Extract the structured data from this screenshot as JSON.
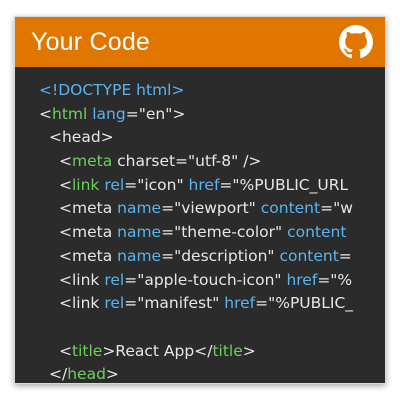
{
  "header": {
    "title": "Your Code",
    "icon": "github-icon",
    "accent_color": "#e07600"
  },
  "code": {
    "background": "#2b2b2b",
    "lines": [
      {
        "indent": 1,
        "tokens": [
          {
            "t": "<!DOCTYPE html>",
            "c": "attr"
          }
        ]
      },
      {
        "indent": 1,
        "tokens": [
          {
            "t": "<",
            "c": "white"
          },
          {
            "t": "html",
            "c": "tag"
          },
          {
            "t": " ",
            "c": "white"
          },
          {
            "t": "lang",
            "c": "attr"
          },
          {
            "t": "=\"en\">",
            "c": "white"
          }
        ]
      },
      {
        "indent": 2,
        "tokens": [
          {
            "t": "<head>",
            "c": "white"
          }
        ]
      },
      {
        "indent": 3,
        "tokens": [
          {
            "t": "<",
            "c": "white"
          },
          {
            "t": "meta",
            "c": "tag"
          },
          {
            "t": " charset=\"utf-8\" />",
            "c": "white"
          }
        ]
      },
      {
        "indent": 3,
        "tokens": [
          {
            "t": "<",
            "c": "white"
          },
          {
            "t": "link",
            "c": "tag"
          },
          {
            "t": " ",
            "c": "white"
          },
          {
            "t": "rel",
            "c": "attr"
          },
          {
            "t": "=\"icon\" ",
            "c": "white"
          },
          {
            "t": "href",
            "c": "attr"
          },
          {
            "t": "=\"%PUBLIC_URL",
            "c": "white"
          }
        ]
      },
      {
        "indent": 3,
        "tokens": [
          {
            "t": "<meta ",
            "c": "white"
          },
          {
            "t": "name",
            "c": "attr"
          },
          {
            "t": "=\"viewport\" ",
            "c": "white"
          },
          {
            "t": "content",
            "c": "attr"
          },
          {
            "t": "=\"w",
            "c": "white"
          }
        ]
      },
      {
        "indent": 3,
        "tokens": [
          {
            "t": "<meta ",
            "c": "white"
          },
          {
            "t": "name",
            "c": "attr"
          },
          {
            "t": "=\"theme-color\" ",
            "c": "white"
          },
          {
            "t": "content",
            "c": "attr"
          }
        ]
      },
      {
        "indent": 3,
        "tokens": [
          {
            "t": "<meta ",
            "c": "white"
          },
          {
            "t": "name",
            "c": "attr"
          },
          {
            "t": "=\"description\" ",
            "c": "white"
          },
          {
            "t": "content",
            "c": "attr"
          },
          {
            "t": "=",
            "c": "white"
          }
        ]
      },
      {
        "indent": 3,
        "tokens": [
          {
            "t": "<link ",
            "c": "white"
          },
          {
            "t": "rel",
            "c": "attr"
          },
          {
            "t": "=\"apple-touch-icon\" ",
            "c": "white"
          },
          {
            "t": "href",
            "c": "attr"
          },
          {
            "t": "=\"%",
            "c": "white"
          }
        ]
      },
      {
        "indent": 3,
        "tokens": [
          {
            "t": "<link ",
            "c": "white"
          },
          {
            "t": "rel",
            "c": "attr"
          },
          {
            "t": "=\"manifest\" ",
            "c": "white"
          },
          {
            "t": "href",
            "c": "attr"
          },
          {
            "t": "=\"%PUBLIC_",
            "c": "white"
          }
        ]
      },
      {
        "indent": 0,
        "tokens": []
      },
      {
        "indent": 3,
        "tokens": [
          {
            "t": "<",
            "c": "white"
          },
          {
            "t": "title",
            "c": "tag"
          },
          {
            "t": ">React App</",
            "c": "white"
          },
          {
            "t": "title",
            "c": "tag"
          },
          {
            "t": ">",
            "c": "white"
          }
        ]
      },
      {
        "indent": 2,
        "tokens": [
          {
            "t": "</",
            "c": "white"
          },
          {
            "t": "head",
            "c": "tag"
          },
          {
            "t": ">",
            "c": "white"
          }
        ]
      }
    ]
  }
}
